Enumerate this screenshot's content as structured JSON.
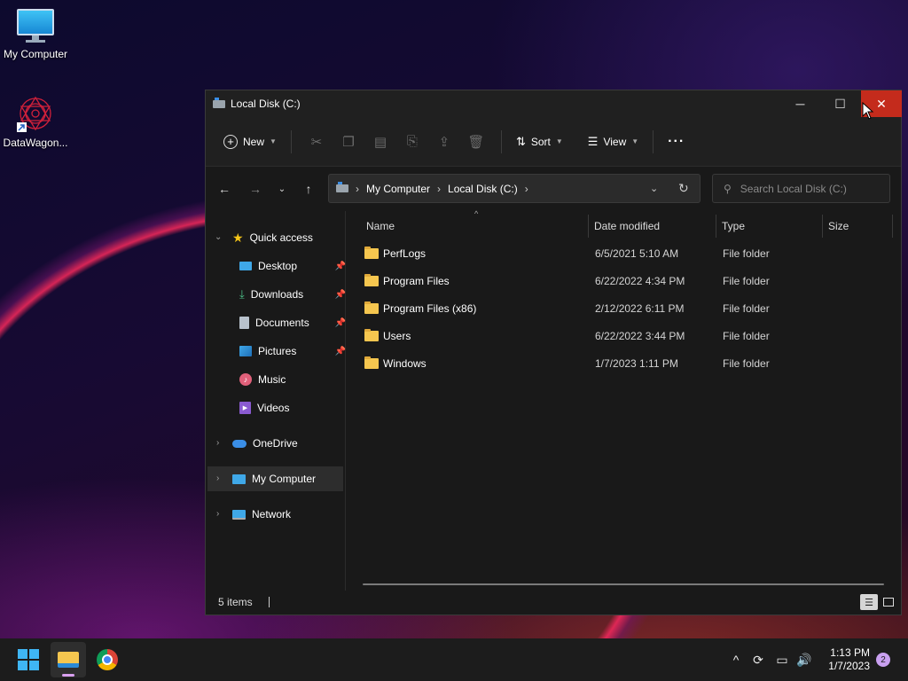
{
  "desktop": {
    "icons": [
      {
        "label": "My Computer"
      },
      {
        "label": "DataWagon..."
      }
    ]
  },
  "window": {
    "title": "Local Disk (C:)",
    "controls": {
      "minimize": "─",
      "maximize": "☐",
      "close": "✕"
    }
  },
  "toolbar": {
    "new_label": "New",
    "sort_label": "Sort",
    "view_label": "View",
    "more_label": "···"
  },
  "address": {
    "crumbs": [
      "My Computer",
      "Local Disk (C:)"
    ],
    "search_placeholder": "Search Local Disk (C:)"
  },
  "sidebar": {
    "quick_access": "Quick access",
    "items": [
      {
        "label": "Desktop",
        "pinned": true
      },
      {
        "label": "Downloads",
        "pinned": true
      },
      {
        "label": "Documents",
        "pinned": true
      },
      {
        "label": "Pictures",
        "pinned": true
      },
      {
        "label": "Music",
        "pinned": false
      },
      {
        "label": "Videos",
        "pinned": false
      }
    ],
    "onedrive": "OneDrive",
    "my_computer": "My Computer",
    "network": "Network"
  },
  "columns": {
    "name": "Name",
    "date": "Date modified",
    "type": "Type",
    "size": "Size"
  },
  "files": [
    {
      "name": "PerfLogs",
      "date": "6/5/2021 5:10 AM",
      "type": "File folder"
    },
    {
      "name": "Program Files",
      "date": "6/22/2022 4:34 PM",
      "type": "File folder"
    },
    {
      "name": "Program Files (x86)",
      "date": "2/12/2022 6:11 PM",
      "type": "File folder"
    },
    {
      "name": "Users",
      "date": "6/22/2022 3:44 PM",
      "type": "File folder"
    },
    {
      "name": "Windows",
      "date": "1/7/2023 1:11 PM",
      "type": "File folder"
    }
  ],
  "status": {
    "items_count": "5 items"
  },
  "taskbar": {
    "time": "1:13 PM",
    "date": "1/7/2023",
    "notification_count": "2"
  },
  "colors": {
    "accent": "#0078d4",
    "close_hover": "#c42b1c",
    "folder": "#f5c64f"
  }
}
